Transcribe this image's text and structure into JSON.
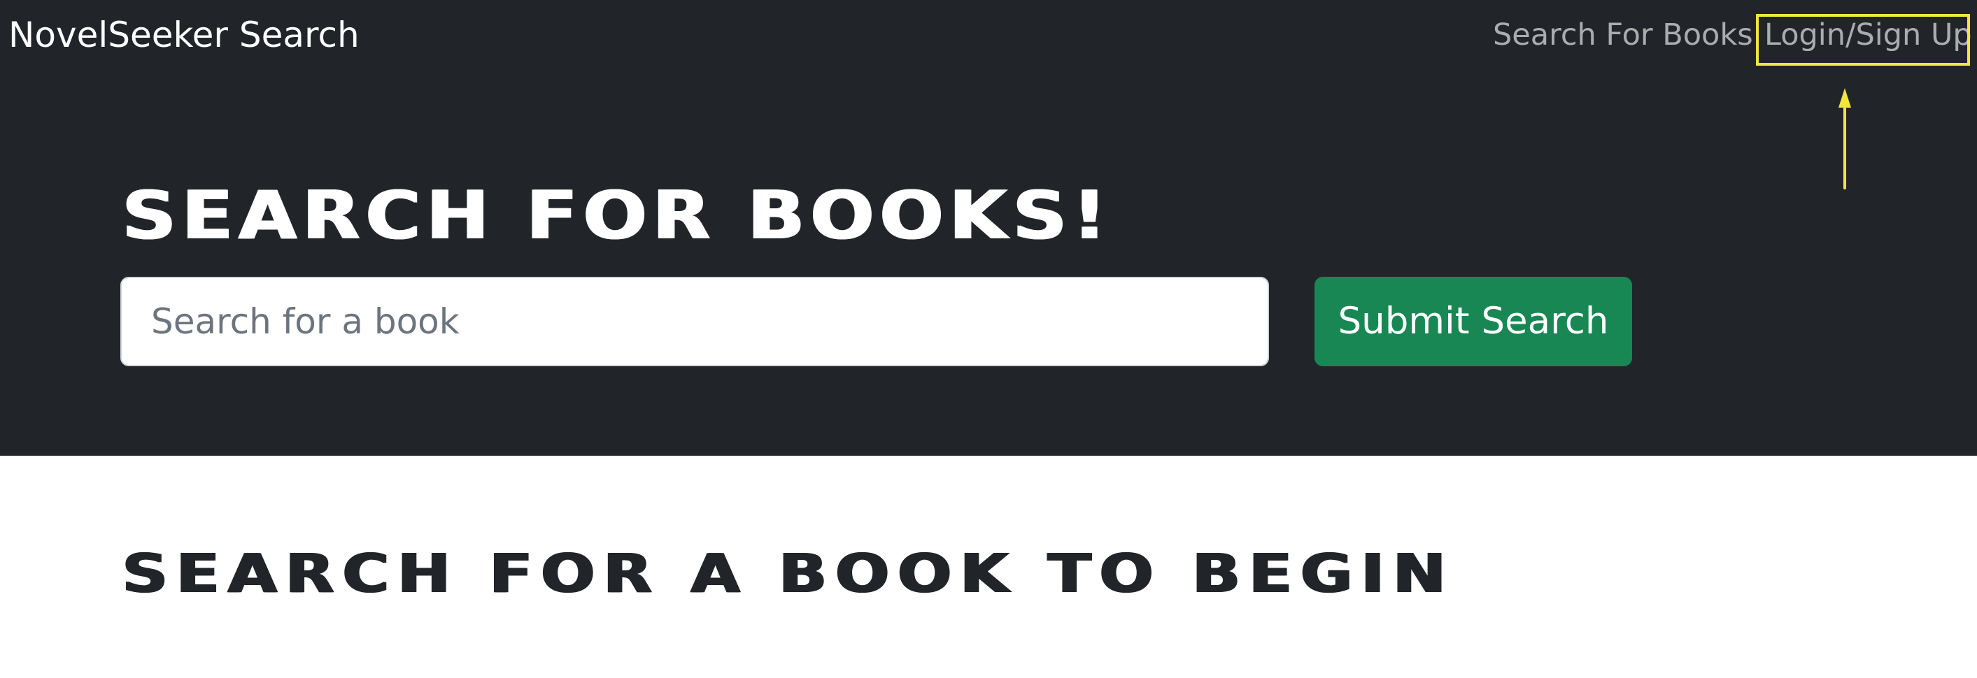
{
  "app": {
    "brand": "NovelSeeker Search"
  },
  "nav": {
    "items": [
      {
        "label": "Search For Books"
      },
      {
        "label": "Login/Sign Up"
      }
    ]
  },
  "hero": {
    "title": "SEARCH FOR BOOKS!",
    "search": {
      "placeholder": "Search for a book",
      "value": ""
    },
    "submit_label": "Submit Search"
  },
  "results": {
    "empty_message": "SEARCH FOR A BOOK TO BEGIN"
  },
  "annotation": {
    "highlight_color": "#f1e73c",
    "target": "Login/Sign Up"
  },
  "colors": {
    "header_background": "#212529",
    "submit_background": "#198754",
    "page_background": "#ffffff"
  }
}
